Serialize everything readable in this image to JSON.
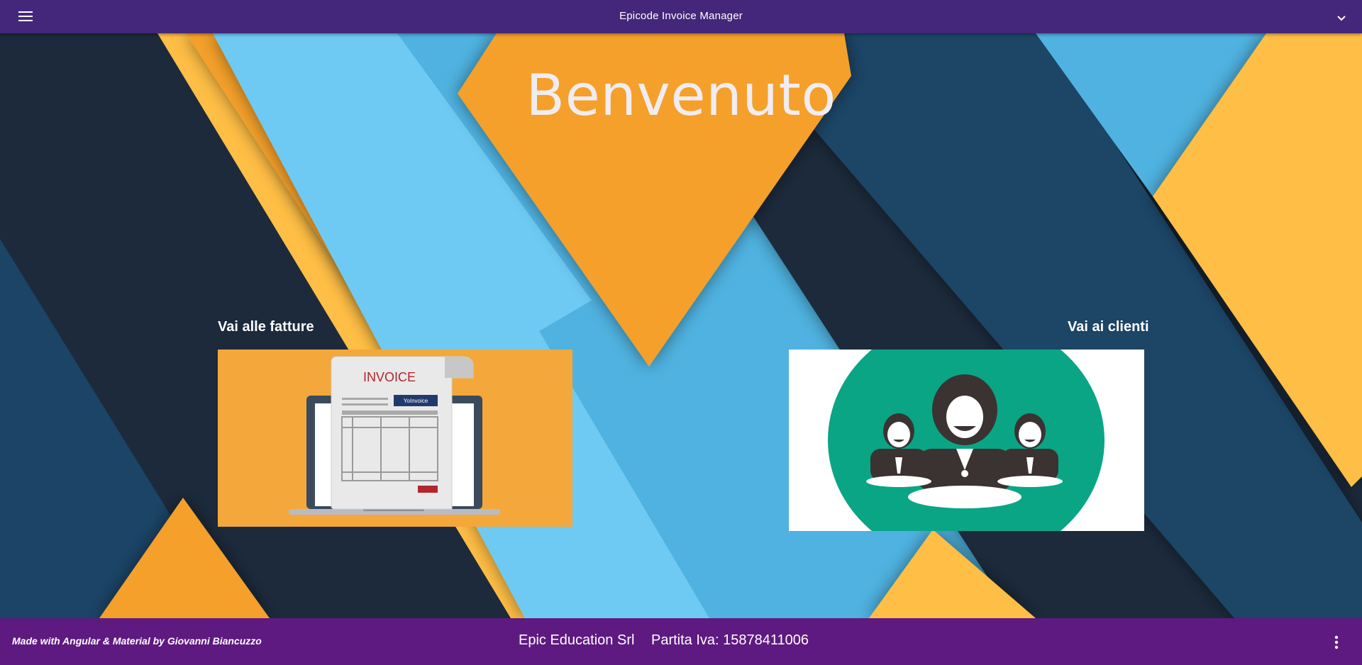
{
  "toolbar": {
    "title": "Epicode Invoice Manager",
    "menu_icon": "menu-icon",
    "dropdown_icon": "chevron-down-icon",
    "color": "#44277a"
  },
  "main": {
    "welcome": "Benvenuto",
    "invoices_link": "Vai alle fatture",
    "clients_link": "Vai ai clienti",
    "invoice_card": {
      "heading": "INVOICE",
      "brand": "YoInvoice"
    }
  },
  "footer": {
    "credits": "Made with Angular & Material by Giovanni Biancuzzo",
    "company": "Epic Education Srl",
    "vat": "Partita Iva: 15878411006",
    "more_icon": "more-vert-icon",
    "color": "#5e1a80"
  }
}
